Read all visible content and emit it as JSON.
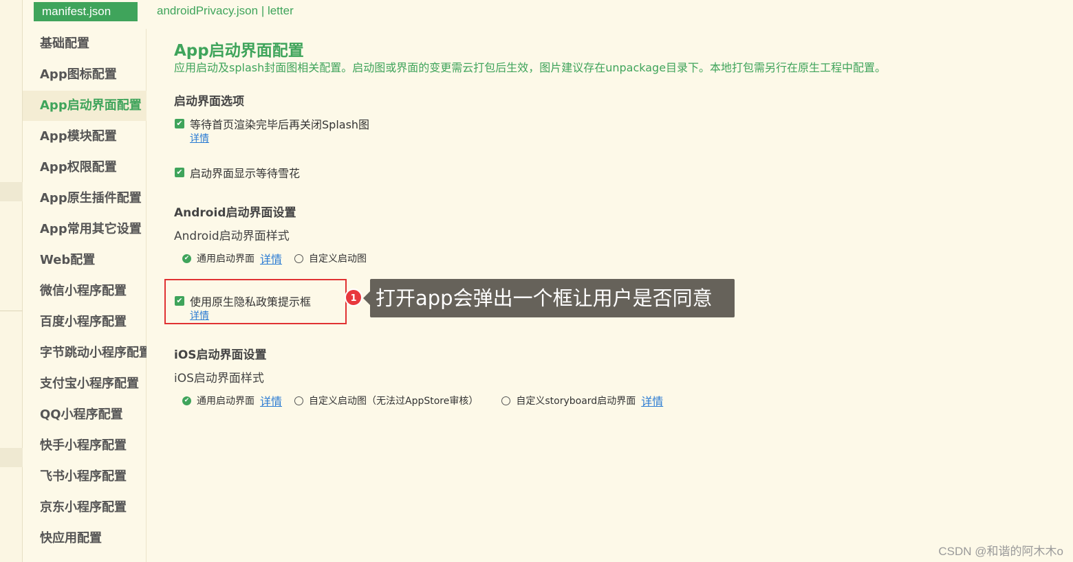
{
  "tabs": {
    "active": "manifest.json",
    "others": "androidPrivacy.json | letter"
  },
  "sidebar": {
    "items": [
      {
        "label": "基础配置"
      },
      {
        "label": "App图标配置"
      },
      {
        "label": "App启动界面配置"
      },
      {
        "label": "App模块配置"
      },
      {
        "label": "App权限配置"
      },
      {
        "label": "App原生插件配置"
      },
      {
        "label": "App常用其它设置"
      },
      {
        "label": "Web配置"
      },
      {
        "label": "微信小程序配置"
      },
      {
        "label": "百度小程序配置"
      },
      {
        "label": "字节跳动小程序配置"
      },
      {
        "label": "支付宝小程序配置"
      },
      {
        "label": "QQ小程序配置"
      },
      {
        "label": "快手小程序配置"
      },
      {
        "label": "飞书小程序配置"
      },
      {
        "label": "京东小程序配置"
      },
      {
        "label": "快应用配置"
      }
    ],
    "active_index": 2
  },
  "main": {
    "title": "App启动界面配置",
    "description": "应用启动及splash封面图相关配置。启动图或界面的变更需云打包后生效，图片建议存在unpackage目录下。本地打包需另行在原生工程中配置。",
    "splash_options": {
      "title": "启动界面选项",
      "wait_render": {
        "label": "等待首页渲染完毕后再关闭Splash图",
        "checked": true,
        "detail": "详情"
      },
      "show_waiting": {
        "label": "启动界面显示等待雪花",
        "checked": true
      }
    },
    "android": {
      "title": "Android启动界面设置",
      "style_label": "Android启动界面样式",
      "options": [
        {
          "label": "通用启动界面",
          "selected": true,
          "detail": "详情"
        },
        {
          "label": "自定义启动图",
          "selected": false
        }
      ],
      "privacy": {
        "label": "使用原生隐私政策提示框",
        "checked": true,
        "detail": "详情"
      }
    },
    "ios": {
      "title": "iOS启动界面设置",
      "style_label": "iOS启动界面样式",
      "options": [
        {
          "label": "通用启动界面",
          "selected": true,
          "detail": "详情"
        },
        {
          "label": "自定义启动图（无法过AppStore审核）",
          "selected": false
        },
        {
          "label": "自定义storyboard启动界面",
          "selected": false,
          "detail": "详情"
        }
      ]
    }
  },
  "annotation": {
    "badge": "1",
    "callout": "打开app会弹出一个框让用户是否同意",
    "highlight_color": "#e03131",
    "badge_color": "#e8383d"
  },
  "watermark": "CSDN @和谐的阿木木o",
  "colors": {
    "accent": "#3fa45b",
    "link": "#2a7bd3",
    "background": "#fdf9e8"
  }
}
